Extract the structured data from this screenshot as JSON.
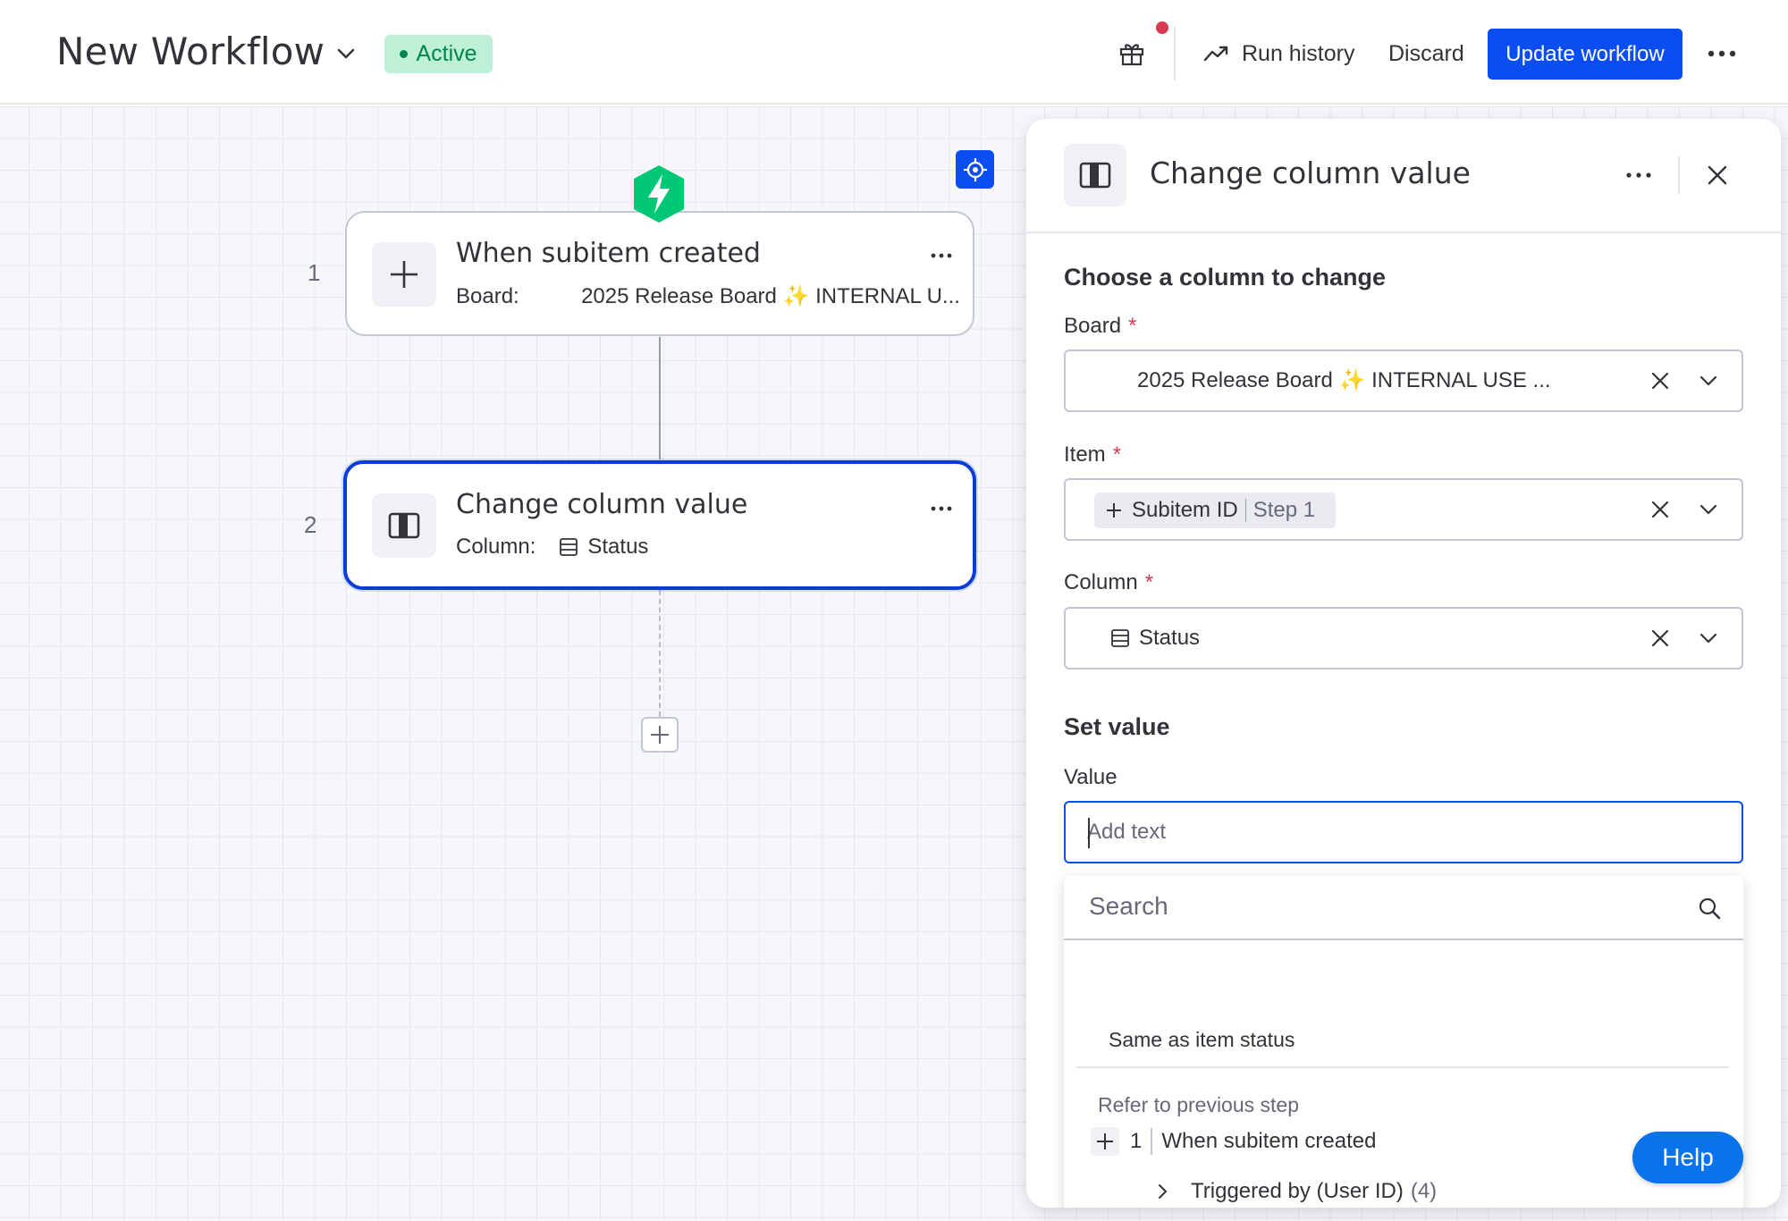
{
  "header": {
    "workflow_title": "New Workflow",
    "status_label": "Active",
    "run_history_label": "Run history",
    "discard_label": "Discard",
    "update_label": "Update workflow",
    "icons": [
      "chevron-down-icon",
      "gift-icon",
      "trend-icon",
      "more-horizontal-icon"
    ]
  },
  "canvas": {
    "steps": [
      {
        "number": "1",
        "title": "When subitem created",
        "sub_label": "Board:",
        "sub_value_prefix": "2025 Release Board",
        "sub_value_emoji": "✨",
        "sub_value_suffix": "INTERNAL U...",
        "icon": "plus-icon"
      },
      {
        "number": "2",
        "title": "Change column value",
        "sub_label": "Column:",
        "sub_value": "Status",
        "icon": "column-icon",
        "selected": true
      }
    ]
  },
  "panel": {
    "title": "Change column value",
    "section_choose": "Choose a column to change",
    "board_label": "Board",
    "board_value_prefix": "2025 Release Board",
    "board_value_emoji": "✨",
    "board_value_suffix": "INTERNAL USE ...",
    "item_label": "Item",
    "item_chip_name": "Subitem ID",
    "item_chip_step": "Step 1",
    "column_label": "Column",
    "column_value": "Status",
    "required_mark": "*",
    "section_set_value": "Set value",
    "value_label": "Value",
    "value_placeholder": "Add text",
    "dropdown": {
      "search_placeholder": "Search",
      "option_same": "Same as item status",
      "group_label": "Refer to previous step",
      "step_number": "1",
      "step_name": "When subitem created",
      "sub_option": "Triggered by (User ID)",
      "sub_option_count": "(4)"
    }
  },
  "help_label": "Help",
  "colors": {
    "primary": "#0a4df0",
    "active_bg": "#bdf0d6",
    "active_text": "#00854d",
    "trigger_green": "#00c875",
    "required": "#d83a52"
  }
}
